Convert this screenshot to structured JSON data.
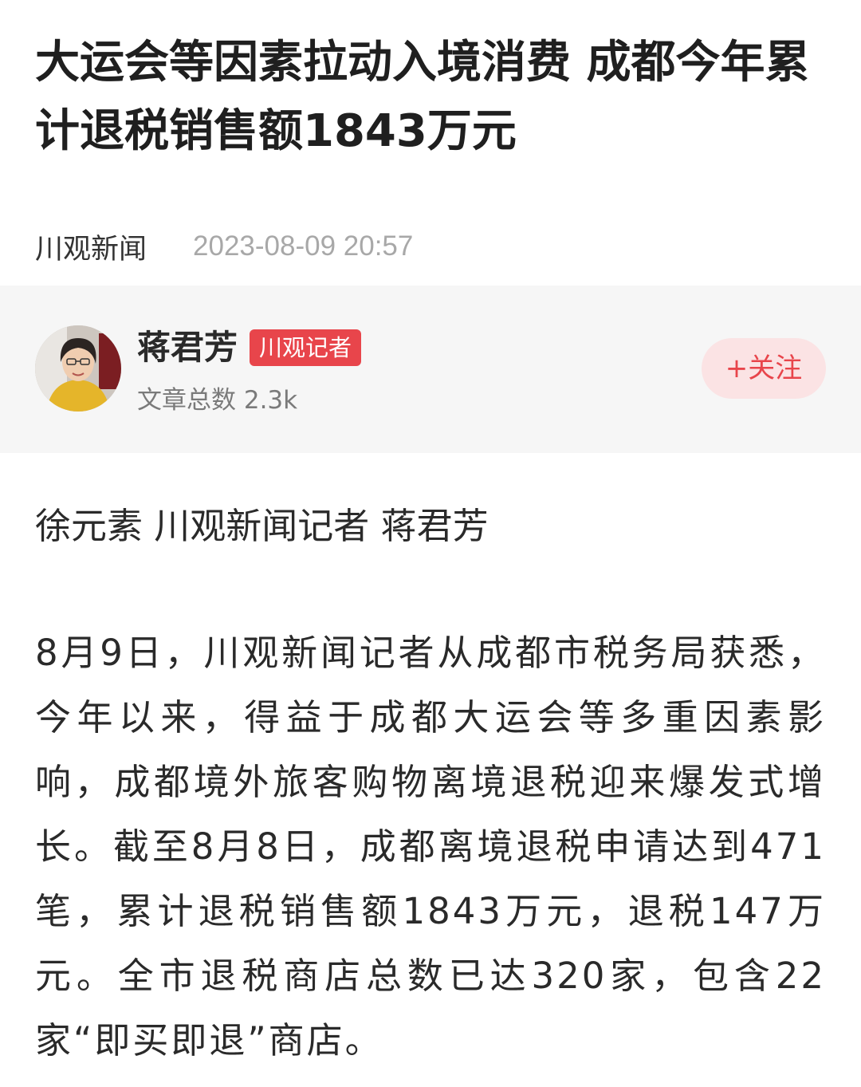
{
  "article": {
    "title": "大运会等因素拉动入境消费 成都今年累计退税销售额1843万元",
    "source": "川观新闻",
    "published_at": "2023-08-09 20:57",
    "byline": "徐元素 川观新闻记者 蒋君芳",
    "paragraph_1": "8月9日，川观新闻记者从成都市税务局获悉，今年以来，得益于成都大运会等多重因素影响，成都境外旅客购物离境退税迎来爆发式增长。截至8月8日，成都离境退税申请达到471笔，累计退税销售额1843万元，退税147万元。全市退税商店总数已达320家，包含22家“即买即退”商店。"
  },
  "author": {
    "name": "蒋君芳",
    "badge": "川观记者",
    "article_count_label": "文章总数",
    "article_count": "2.3k",
    "follow_label": "+关注",
    "avatar_icon": "avatar-photo-icon"
  },
  "colors": {
    "accent": "#e8454b",
    "follow_bg": "#fbe3e4",
    "card_bg": "#f6f6f6",
    "meta_gray": "#a8a8a8"
  }
}
